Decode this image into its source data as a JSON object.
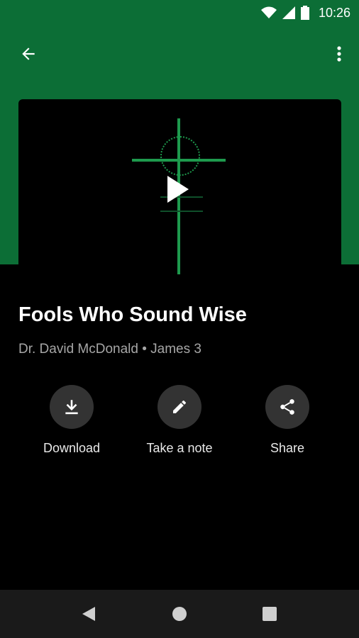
{
  "status": {
    "time": "10:26"
  },
  "episode": {
    "title": "Fools Who Sound Wise",
    "subtitle": "Dr. David McDonald • James 3"
  },
  "actions": [
    {
      "label": "Download",
      "icon": "download-icon"
    },
    {
      "label": "Take a note",
      "icon": "pencil-icon"
    },
    {
      "label": "Share",
      "icon": "share-icon"
    }
  ],
  "colors": {
    "header_green": "#0c6e36",
    "accent_green": "#1e9a4d",
    "action_circle": "#333333"
  }
}
